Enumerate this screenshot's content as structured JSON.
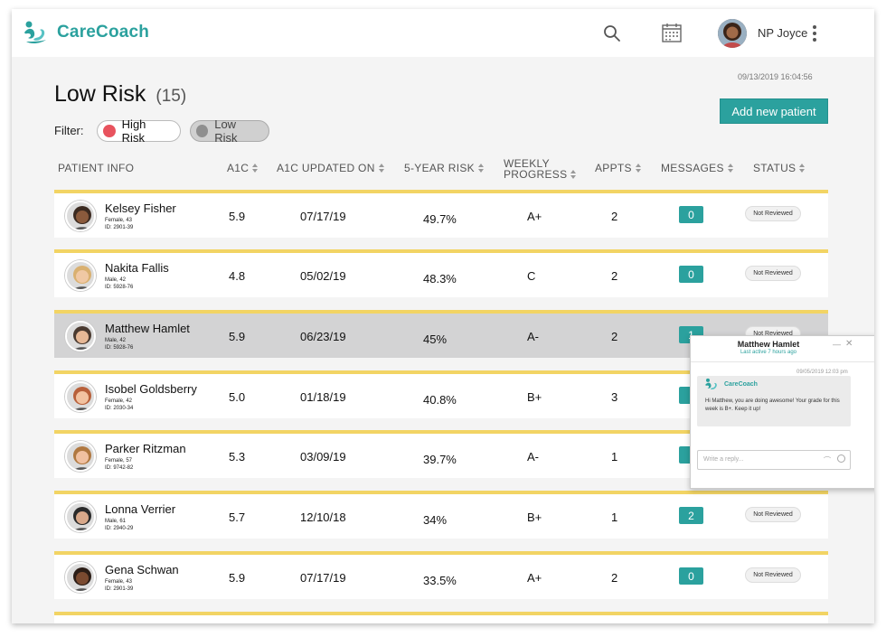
{
  "app": {
    "name": "CareCoach"
  },
  "header": {
    "user_name": "NP Joyce"
  },
  "timestamp": "09/13/2019 16:04:56",
  "page": {
    "title": "Low Risk",
    "count": "(15)"
  },
  "actions": {
    "add_patient": "Add new patient"
  },
  "filter": {
    "label": "Filter:",
    "high_risk": "High Risk",
    "low_risk": "Low Risk"
  },
  "columns": {
    "patient_info": "PATIENT INFO",
    "a1c": "A1C",
    "a1c_updated": "A1C UPDATED ON",
    "five_year_risk": "5-YEAR RISK",
    "weekly_progress_1": "WEEKLY",
    "weekly_progress_2": "PROGRESS",
    "appts": "APPTS",
    "messages": "MESSAGES",
    "status": "STATUS"
  },
  "patients": [
    {
      "name": "Kelsey Fisher",
      "gender_age": "Female, 43",
      "id": "ID: 2901-39",
      "a1c": "5.9",
      "updated": "07/17/19",
      "risk": "49.7%",
      "grade": "A+",
      "appts": "2",
      "messages": "0",
      "status": "Not Reviewed"
    },
    {
      "name": "Nakita Fallis",
      "gender_age": "Male, 42",
      "id": "ID: 5928-76",
      "a1c": "4.8",
      "updated": "05/02/19",
      "risk": "48.3%",
      "grade": "C",
      "appts": "2",
      "messages": "0",
      "status": "Not Reviewed"
    },
    {
      "name": "Matthew Hamlet",
      "gender_age": "Male, 42",
      "id": "ID: 5928-76",
      "a1c": "5.9",
      "updated": "06/23/19",
      "risk": "45%",
      "grade": "A-",
      "appts": "2",
      "messages": "1",
      "status": "Not Reviewed"
    },
    {
      "name": "Isobel Goldsberry",
      "gender_age": "Female, 42",
      "id": "ID: 2030-34",
      "a1c": "5.0",
      "updated": "01/18/19",
      "risk": "40.8%",
      "grade": "B+",
      "appts": "3",
      "messages": "",
      "status": ""
    },
    {
      "name": "Parker Ritzman",
      "gender_age": "Female, 57",
      "id": "ID: 9742-82",
      "a1c": "5.3",
      "updated": "03/09/19",
      "risk": "39.7%",
      "grade": "A-",
      "appts": "1",
      "messages": "",
      "status": ""
    },
    {
      "name": "Lonna Verrier",
      "gender_age": "Male, 61",
      "id": "ID: 2940-29",
      "a1c": "5.7",
      "updated": "12/10/18",
      "risk": "34%",
      "grade": "B+",
      "appts": "1",
      "messages": "2",
      "status": "Not Reviewed"
    },
    {
      "name": "Gena Schwan",
      "gender_age": "Female, 43",
      "id": "ID: 2901-39",
      "a1c": "5.9",
      "updated": "07/17/19",
      "risk": "33.5%",
      "grade": "A+",
      "appts": "2",
      "messages": "0",
      "status": "Not Reviewed"
    }
  ],
  "chat": {
    "name": "Matthew Hamlet",
    "last_active": "Last active 7 hours ago",
    "time": "09/05/2019 12:03 pm",
    "brand": "CareCoach",
    "message": "Hi Matthew, you are doing awesome! Your grade for this week is B+.  Keep it up!",
    "reply_placeholder": "Write a reply..."
  },
  "colors": {
    "accent": "#2ba19e",
    "row_border": "#f2d464",
    "high_risk": "#e8535e",
    "selected_row": "#d3d3d4"
  }
}
